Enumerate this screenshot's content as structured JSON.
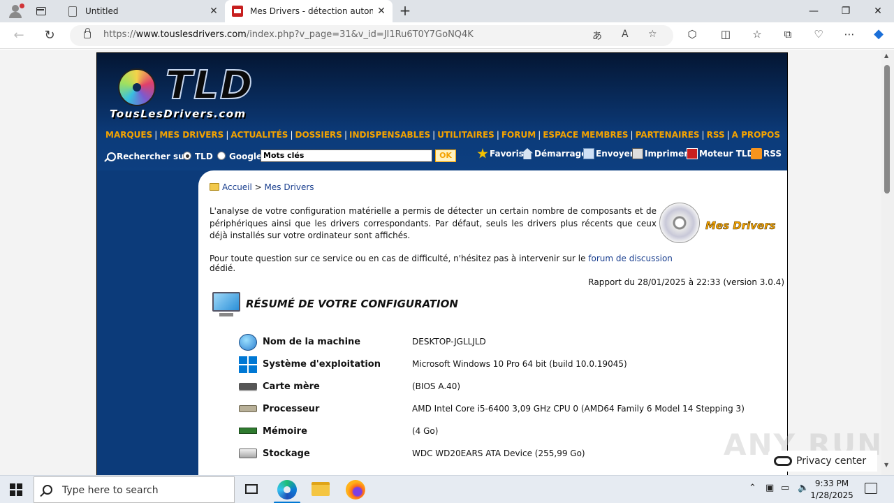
{
  "browser": {
    "tabs": [
      {
        "title": "Untitled",
        "close": "✕"
      },
      {
        "title": "Mes Drivers - détection automatique",
        "close": "✕"
      }
    ],
    "new_tab": "+",
    "window": {
      "minimize": "—",
      "maximize": "❐",
      "close": "✕"
    },
    "nav": {
      "back": "←",
      "refresh": "↻"
    },
    "url_prefix": "https://",
    "url_host": "www.touslesdrivers.com",
    "url_path": "/index.php?v_page=31&v_id=JI1Ru6T0Y7GoNQ4K",
    "icons": [
      "read-aloud-icon",
      "immersive-reader-icon",
      "favorite-star-icon",
      "extensions-icon",
      "split-screen-icon",
      "favorites-icon",
      "collections-icon",
      "browser-essentials-icon",
      "more-icon",
      "copilot-icon"
    ]
  },
  "site": {
    "logo_text": "TLD",
    "logo_sub": "TousLesDrivers.com",
    "menu": [
      "MARQUES",
      "MES DRIVERS",
      "ACTUALITÉS",
      "DOSSIERS",
      "INDISPENSABLES",
      "UTILITAIRES",
      "FORUM",
      "ESPACE MEMBRES",
      "PARTENAIRES",
      "RSS",
      "A PROPOS"
    ],
    "search": {
      "label": "Rechercher sur",
      "opt_tld": "TLD",
      "opt_google": "Google",
      "value": "Mots clés",
      "ok": "OK"
    },
    "tools": {
      "favoris": "Favoris",
      "demarrage": "Démarrage",
      "envoyer": "Envoyer",
      "imprimer": "Imprimer",
      "moteur": "Moteur TLD",
      "rss": "RSS"
    },
    "breadcrumb": {
      "home": "Accueil",
      "sep": " > ",
      "current": "Mes Drivers"
    },
    "intro": "L'analyse de votre configuration matérielle a permis de détecter un certain nombre de composants et de périphériques ainsi que les drivers correspondants. Par défaut, seuls les drivers plus récents que ceux déjà installés sur votre ordinateur sont affichés.",
    "intro2_before": "Pour toute question sur ce service ou en cas de difficulté, n'hésitez pas à intervenir sur le ",
    "intro2_link": "forum de discussion",
    "intro2_after": " dédié.",
    "badge": "Mes Drivers",
    "report": "Rapport du 28/01/2025 à 22:33 (version 3.0.4)",
    "section_title": "RÉSUMÉ DE VOTRE CONFIGURATION",
    "specs": [
      {
        "key": "Nom de la machine",
        "value": "DESKTOP-JGLLJLD",
        "icon": "globe-icon"
      },
      {
        "key": "Système d'exploitation",
        "value": "Microsoft Windows 10 Pro 64 bit (build 10.0.19045)",
        "icon": "windows-icon"
      },
      {
        "key": "Carte mère",
        "value": "(BIOS A.40)",
        "icon": "motherboard-icon"
      },
      {
        "key": "Processeur",
        "value": "AMD Intel Core i5-6400 3,09 GHz CPU 0 (AMD64 Family 6 Model 14 Stepping 3)",
        "icon": "cpu-icon"
      },
      {
        "key": "Mémoire",
        "value": "(4 Go)",
        "icon": "ram-icon"
      },
      {
        "key": "Stockage",
        "value": "WDC WD20EARS ATA Device (255,99 Go)",
        "icon": "hdd-icon"
      }
    ]
  },
  "overlay": {
    "privacy": "Privacy center",
    "watermark": "ANY RUN"
  },
  "taskbar": {
    "search_placeholder": "Type here to search",
    "time": "9:33 PM",
    "date": "1/28/2025",
    "tray_icons": [
      "chevron-up-icon",
      "device-icon",
      "network-icon",
      "volume-icon"
    ]
  },
  "colors": {
    "site_blue": "#0c3b7a",
    "menu_orange": "#f4a300",
    "link_blue": "#1a3f8f"
  }
}
